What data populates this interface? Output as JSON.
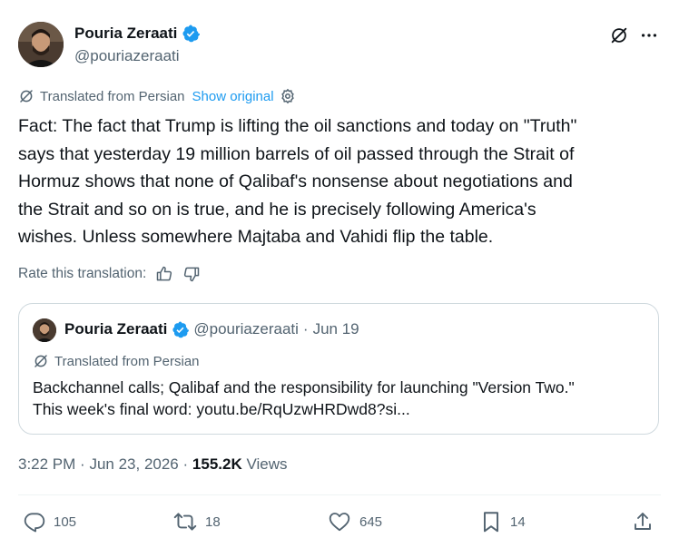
{
  "author": {
    "name": "Pouria Zeraati",
    "handle": "@pouriazeraati"
  },
  "translation": {
    "label": "Translated from Persian",
    "show_original": "Show original"
  },
  "tweet_text": "Fact: The fact that Trump is lifting the oil sanctions and today on \"Truth\"\nsays that yesterday 19 million barrels of oil passed through the Strait of\nHormuz shows that none of Qalibaf's nonsense about negotiations and\nthe Strait and so on is true, and he is precisely following America's\nwishes. Unless somewhere Majtaba and Vahidi flip the table.",
  "rate_label": "Rate this translation:",
  "quote": {
    "name": "Pouria Zeraati",
    "handle": "@pouriazeraati",
    "separator": "·",
    "date": "Jun 19",
    "translated_label": "Translated from Persian",
    "text": "Backchannel calls; Qalibaf and the responsibility for launching \"Version Two.\"\nThis week's final word: youtu.be/RqUzwHRDwd8?si..."
  },
  "meta": {
    "time": "3:22 PM",
    "dot1": "·",
    "date": "Jun 23, 2026",
    "dot2": "·",
    "views_count": "155.2K",
    "views_label": "Views"
  },
  "actions": {
    "replies": "105",
    "reposts": "18",
    "likes": "645",
    "bookmarks": "14"
  },
  "colors": {
    "accent": "#1d9bf0",
    "secondary_text": "#536471",
    "primary_text": "#0f1419",
    "repost_green": "#00ba7c"
  }
}
